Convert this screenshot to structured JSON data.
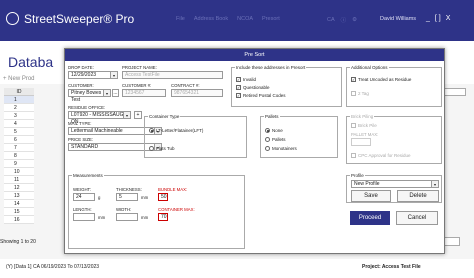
{
  "app": {
    "name": "StreetSweeper® Pro",
    "menu": [
      "File",
      "Address Book",
      "NCOA",
      "Presort"
    ],
    "status_ca": "CA",
    "user": "David Williams",
    "win_controls": [
      "_",
      "[ ]",
      "X"
    ]
  },
  "page": {
    "title": "Databa",
    "new_prod": "+ New Prod",
    "dimc": "DIMC",
    "showing": "Showing 1 to 20",
    "pager_value": "20",
    "footer_left": "(Y) [Data 1] CA  06/19/2023 To 07/13/2023",
    "footer_right": "Project:  Access Test File"
  },
  "grid": {
    "header": "ID",
    "rows": [
      "1",
      "2",
      "3",
      "4",
      "5",
      "6",
      "7",
      "8",
      "9",
      "10",
      "11",
      "12",
      "13",
      "14",
      "15",
      "16"
    ]
  },
  "dialog": {
    "title": "Pre Sort",
    "drop_date_label": "DROP DATE:",
    "drop_date": "12/29/2023",
    "project_name_label": "PROJECT NAME:",
    "project_name": "Access TestFile",
    "customer_label": "CUSTOMER:",
    "customer": "Pitney Bowes Test",
    "customer_no_label": "CUSTOMER #:",
    "customer_no": "1234567",
    "contract_label": "CONTRACT #:",
    "contract_no": "987654321",
    "residue_office_label": "RESIDUE OFFICE:",
    "residue_office": "L0T920 - MISSISSAUGA ON",
    "mail_type_label": "MAIL TYPE:",
    "mail_type": "Lettermail Machineable",
    "price_size_label": "PRICE SIZE:",
    "price_size": "STANDARD",
    "include_title": "Include these addresses in Presort",
    "include": [
      {
        "label": "Invalid",
        "checked": true
      },
      {
        "label": "Questionable",
        "checked": true
      },
      {
        "label": "Retired Postal Codes",
        "checked": true
      }
    ],
    "additional_title": "Additional Options",
    "additional": [
      {
        "label": "Treat Uncoded as Residue",
        "checked": true
      },
      {
        "label": "2 Tag",
        "checked": false
      }
    ],
    "container_title": "Container Type",
    "container": [
      {
        "label": "LT-Letter/Flatainer(LFT)",
        "on": true
      },
      {
        "label": "Flats Tub",
        "on": false
      }
    ],
    "pallets_title": "Pallets",
    "pallets": [
      {
        "label": "None",
        "on": true
      },
      {
        "label": "Pallets",
        "on": false
      },
      {
        "label": "Monotainers",
        "on": false
      }
    ],
    "brick_title": "Brick Piling",
    "brick_pile": "Brick Pile",
    "pallet_max_label": "PALLET MAX:",
    "cpc_approval": "CPC Approval for Residue",
    "measurements_title": "Measurements",
    "weight_label": "WEIGHT:",
    "weight": "24",
    "weight_unit": "g",
    "thickness_label": "THICKNESS:",
    "thickness": "5",
    "thickness_unit": "mm",
    "bundle_max_label": "BUNDLE MAX:",
    "bundle_max": "50",
    "length_label": "LENGTH:",
    "length_unit": "mm",
    "width_label": "WIDTH:",
    "width_unit": "mm",
    "container_max_label": "CONTAINER MAX:",
    "container_max": "70",
    "profile_title": "Profile",
    "profile": "New Profile",
    "save": "Save",
    "delete": "Delete",
    "proceed": "Proceed",
    "cancel": "Cancel"
  }
}
